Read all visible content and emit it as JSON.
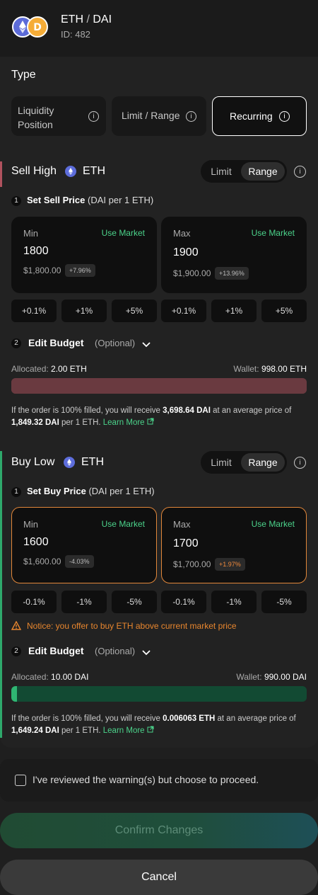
{
  "header": {
    "base": "ETH",
    "separator": "/",
    "quote": "DAI",
    "id_text": "ID: 482",
    "base_icon": "eth-icon",
    "quote_icon": "dai-icon"
  },
  "type_section": {
    "title": "Type",
    "options": [
      {
        "label_line1": "Liquidity",
        "label_line2": "Position",
        "selected": false
      },
      {
        "label": "Limit / Range",
        "selected": false
      },
      {
        "label": "Recurring",
        "selected": true
      }
    ]
  },
  "sell": {
    "title": "Sell High",
    "token": "ETH",
    "toggle": {
      "left": "Limit",
      "right": "Range",
      "selected": "Range"
    },
    "step1_num": "1",
    "step1_label": "Set Sell Price",
    "step1_unit": "(DAI per 1 ETH)",
    "min": {
      "label": "Min",
      "use_market": "Use Market",
      "value": "1800",
      "usd": "$1,800.00",
      "pct": "+7.96%"
    },
    "max": {
      "label": "Max",
      "use_market": "Use Market",
      "value": "1900",
      "usd": "$1,900.00",
      "pct": "+13.96%"
    },
    "steps": [
      "+0.1%",
      "+1%",
      "+5%",
      "+0.1%",
      "+1%",
      "+5%"
    ],
    "step2_num": "2",
    "edit_budget": "Edit Budget",
    "optional": "(Optional)",
    "allocated_label": "Allocated:",
    "allocated_value": "2.00 ETH",
    "wallet_label": "Wallet:",
    "wallet_value": "998.00 ETH",
    "allocated_fraction": 1.0,
    "note_pre": "If the order is 100% filled, you will receive ",
    "note_receive": "3,698.64 DAI",
    "note_mid": " at an average price of ",
    "note_price": "1,849.32 DAI",
    "note_post": " per 1 ETH. ",
    "learn_more": "Learn More"
  },
  "buy": {
    "title": "Buy Low",
    "token": "ETH",
    "toggle": {
      "left": "Limit",
      "right": "Range",
      "selected": "Range"
    },
    "step1_num": "1",
    "step1_label": "Set Buy Price",
    "step1_unit": "(DAI per 1 ETH)",
    "min": {
      "label": "Min",
      "use_market": "Use Market",
      "value": "1600",
      "usd": "$1,600.00",
      "pct": "-4.03%"
    },
    "max": {
      "label": "Max",
      "use_market": "Use Market",
      "value": "1700",
      "usd": "$1,700.00",
      "pct": "+1.97%"
    },
    "steps": [
      "-0.1%",
      "-1%",
      "-5%",
      "-0.1%",
      "-1%",
      "-5%"
    ],
    "notice": "Notice: you offer to buy ETH above current market price",
    "step2_num": "2",
    "edit_budget": "Edit Budget",
    "optional": "(Optional)",
    "allocated_label": "Allocated:",
    "allocated_value": "10.00 DAI",
    "wallet_label": "Wallet:",
    "wallet_value": "990.00 DAI",
    "allocated_fraction": 0.01,
    "note_pre": "If the order is 100% filled, you will receive ",
    "note_receive": "0.006063 ETH",
    "note_mid": " at an average price of ",
    "note_price": "1,649.24 DAI",
    "note_post": " per 1 ETH. ",
    "learn_more": "Learn More"
  },
  "acknowledge": {
    "label": "I've reviewed the warning(s) but choose to proceed.",
    "checked": false
  },
  "actions": {
    "confirm": "Confirm Changes",
    "cancel": "Cancel"
  },
  "colors": {
    "sell_accent": "#b0525e",
    "buy_accent": "#2ea86b",
    "market_green": "#4bd28a",
    "warning_orange": "#e8862e",
    "sell_track": "#5e3338",
    "buy_track": "#124a33"
  }
}
